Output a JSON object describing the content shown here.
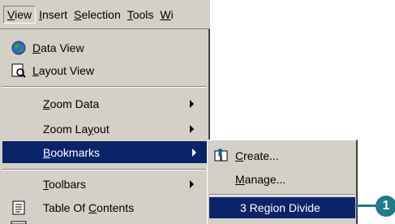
{
  "menubar": {
    "items": [
      {
        "pre": "",
        "key": "V",
        "post": "iew"
      },
      {
        "pre": "",
        "key": "I",
        "post": "nsert"
      },
      {
        "pre": "",
        "key": "S",
        "post": "election"
      },
      {
        "pre": "",
        "key": "T",
        "post": "ools"
      },
      {
        "pre": "",
        "key": "W",
        "post": "i"
      }
    ]
  },
  "view_menu": {
    "data_view": {
      "pre": "",
      "key": "D",
      "post": "ata View"
    },
    "layout_view": {
      "pre": "",
      "key": "L",
      "post": "ayout View"
    },
    "zoom_data": {
      "pre": "",
      "key": "Z",
      "post": "oom Data"
    },
    "zoom_layout": {
      "pre": "Zoom La",
      "key": "y",
      "post": "out"
    },
    "bookmarks": {
      "pre": "",
      "key": "B",
      "post": "ookmarks"
    },
    "toolbars": {
      "pre": "",
      "key": "T",
      "post": "oolbars"
    },
    "toc": {
      "pre": "Table Of ",
      "key": "C",
      "post": "ontents"
    }
  },
  "bookmarks_menu": {
    "create": {
      "pre": "",
      "key": "C",
      "post": "reate..."
    },
    "manage": {
      "pre": "",
      "key": "M",
      "post": "anage..."
    },
    "bookmark_1": "3 Region Divide"
  },
  "callout": {
    "number": "1"
  },
  "colors": {
    "menu_bg": "#d4d0c8",
    "highlight": "#0a246a",
    "callout": "#1f7a8c"
  }
}
